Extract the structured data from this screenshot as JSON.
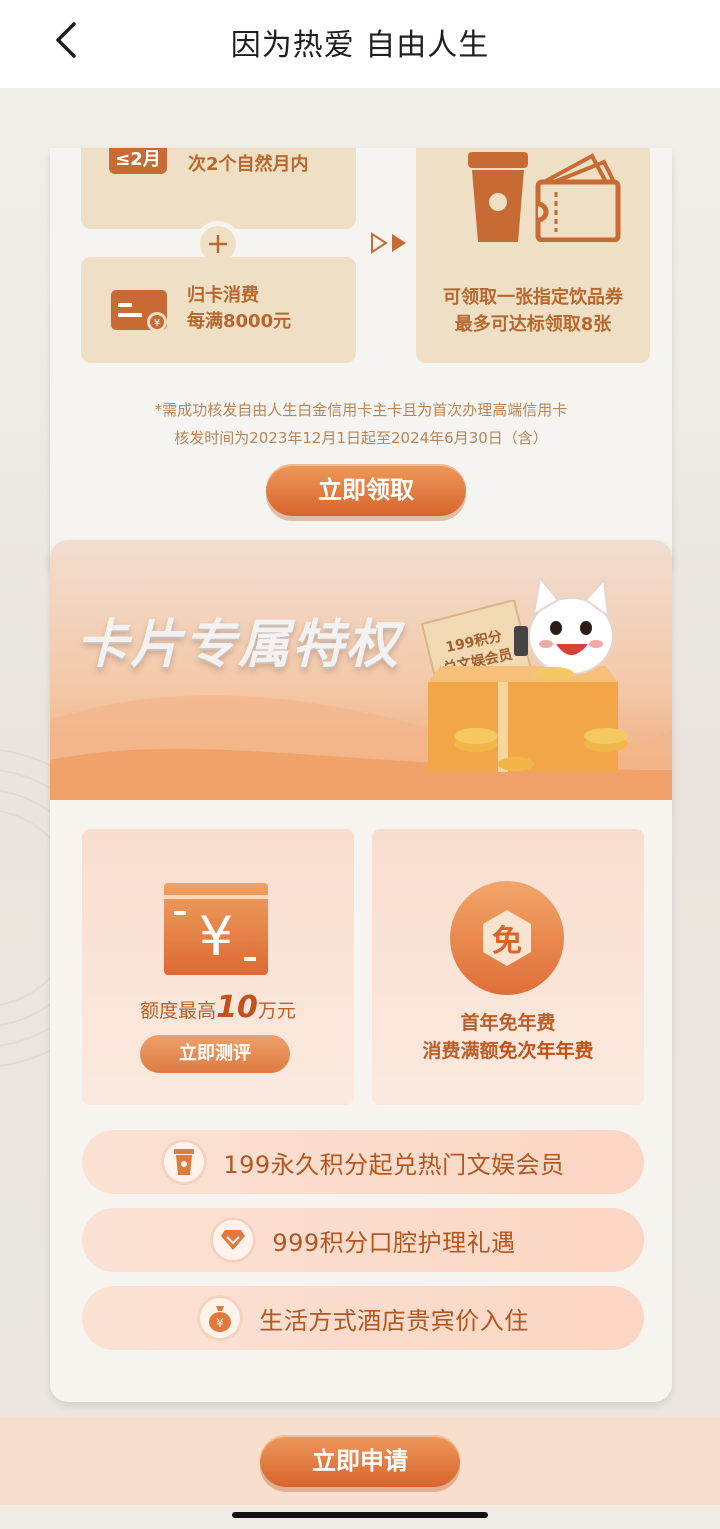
{
  "nav": {
    "title": "因为热爱 自由人生"
  },
  "promo": {
    "month_badge": "≤2月",
    "step1_text": "次2个自然月内",
    "step2_line1": "归卡消费",
    "step2_line2": "每满8000元",
    "reward_line1": "可领取一张指定饮品券",
    "reward_line2": "最多可达标领取8张",
    "note_line1": "*需成功核发自由人生白金信用卡主卡且为首次办理高端信用卡",
    "note_line2": "核发时间为2023年12月1日起至2024年6月30日（含）",
    "claim_button": "立即领取"
  },
  "privileges": {
    "banner_title": "卡片专属特权",
    "ticket_line1": "199积分",
    "ticket_line2": "兑文娱会员",
    "limit_prefix": "额度最高",
    "limit_value": "10",
    "limit_suffix": "万元",
    "eval_button": "立即测评",
    "fee_badge": "免",
    "fee_line1": "首年免年费",
    "fee_line2_a": "消费满额",
    "fee_line2_b": "免次年年费",
    "items": [
      {
        "label": "199永久积分起兑热门文娱会员",
        "icon": "cup-icon"
      },
      {
        "label": "999积分口腔护理礼遇",
        "icon": "diamond-icon"
      },
      {
        "label": "生活方式酒店贵宾价入住",
        "icon": "money-bag-icon"
      }
    ]
  },
  "footer": {
    "apply_button": "立即申请"
  },
  "colors": {
    "accent": "#d8642d",
    "tile": "#efdfc4",
    "text_brown": "#b8682e"
  }
}
